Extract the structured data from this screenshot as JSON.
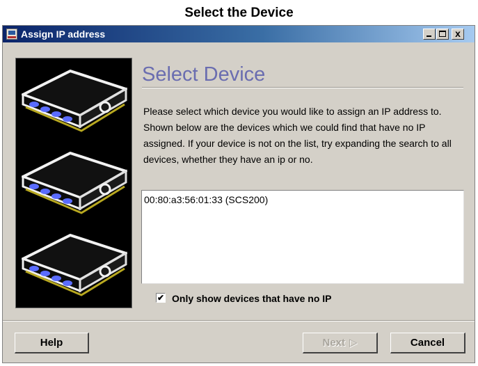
{
  "page": {
    "heading": "Select the Device"
  },
  "window": {
    "title": "Assign IP address",
    "controls": {
      "minimize": "_",
      "maximize": "□",
      "close": "x"
    }
  },
  "wizard": {
    "step_title": "Select Device",
    "instructions": "Please select which device you would like to assign an IP address to.  Shown below are the devices which we could find that have no IP assigned.  If your device is not on the list, try expanding the search to all devices, whether they have an ip or no.",
    "devices": [
      {
        "label": "00:80:a3:56:01:33 (SCS200)"
      }
    ],
    "filter": {
      "checked": true,
      "check_mark": "✔",
      "label": "Only show devices that have no IP"
    }
  },
  "buttons": {
    "help": "Help",
    "next": "Next",
    "next_arrow": "▷",
    "cancel": "Cancel"
  },
  "icons": {
    "app": "computer-icon",
    "side_panel": "network-device-illustration"
  },
  "colors": {
    "title_bar_start": "#0a246a",
    "title_bar_end": "#a6caf0",
    "step_title": "#6a6db0",
    "dialog_bg": "#d4d0c8",
    "device_led": "#5a6cff",
    "device_outline": "#b8a820"
  }
}
